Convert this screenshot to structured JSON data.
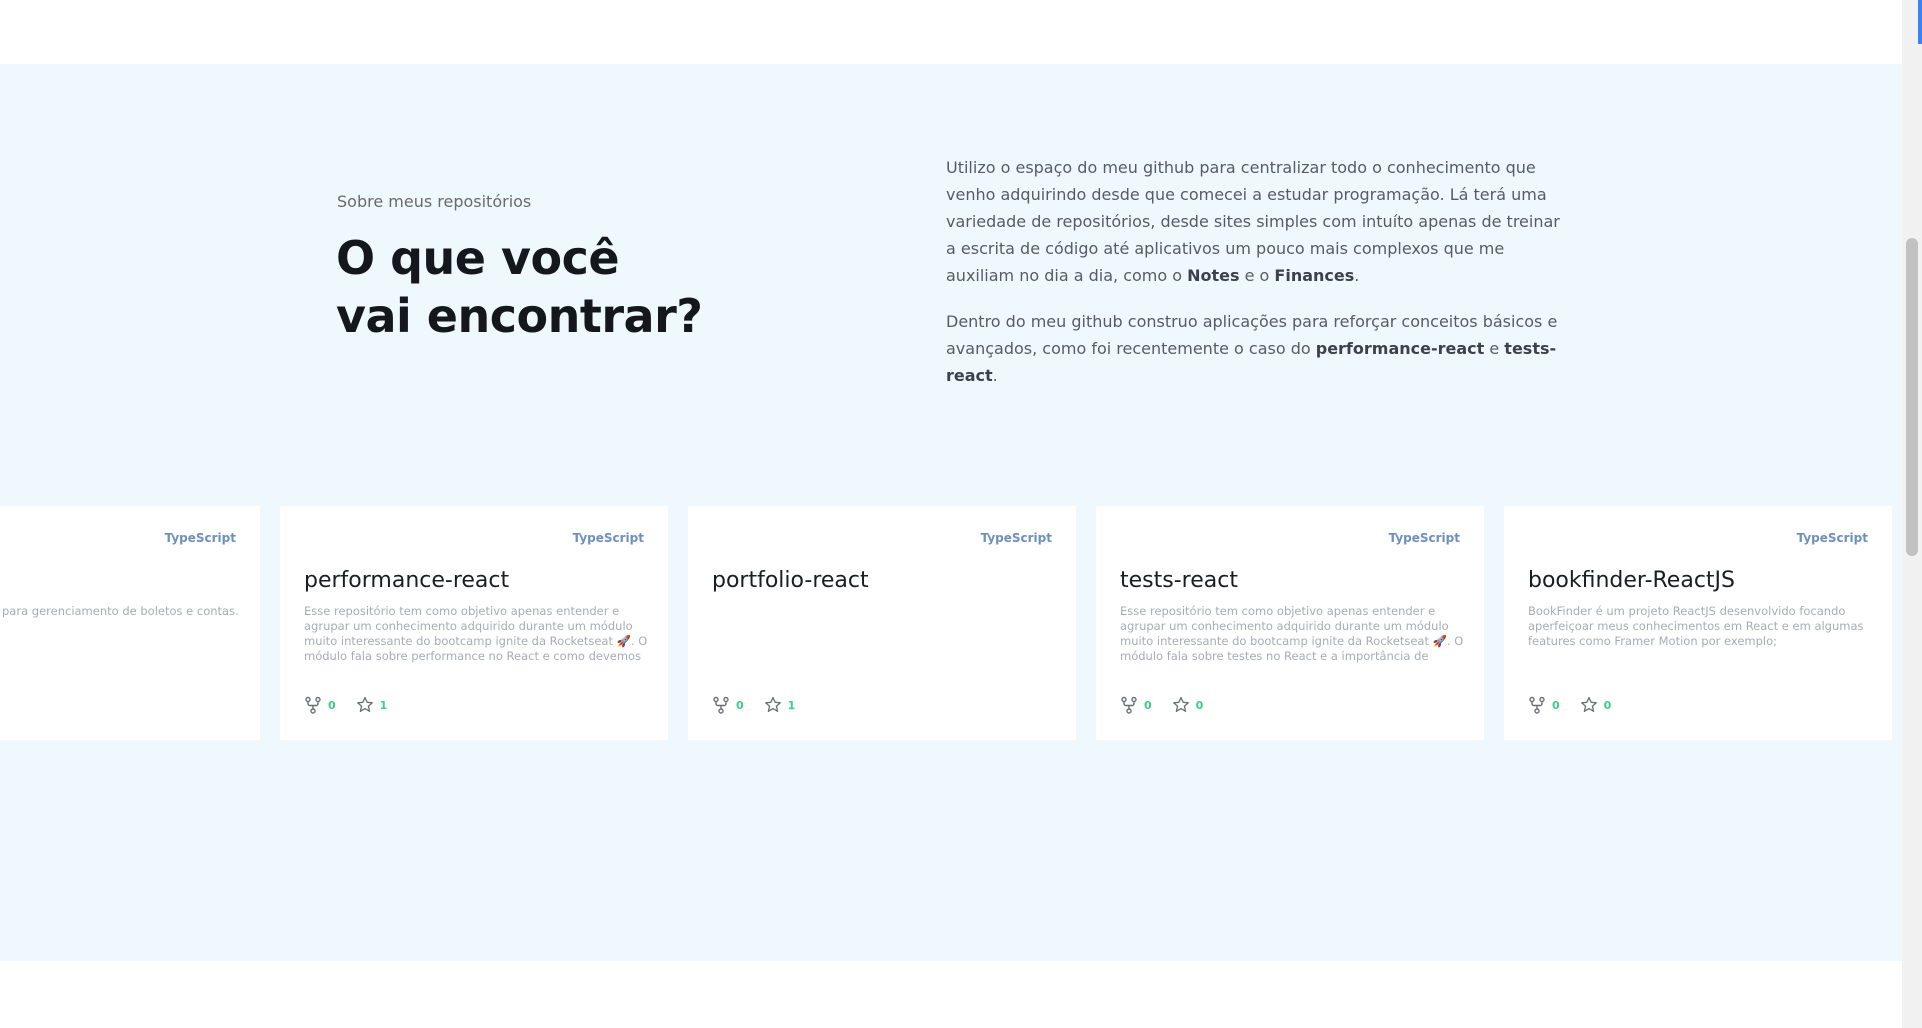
{
  "about": {
    "eyebrow": "Sobre meus repositórios",
    "headline_line1": "O que você",
    "headline_line2": "vai encontrar?",
    "p1_text1": "Utilizo o espaço do meu github para centralizar todo o conhecimento que venho adquirindo desde que comecei a estudar programação. Lá terá uma variedade de repositórios, desde sites simples com intuíto apenas de treinar a escrita de código até aplicativos um pouco mais complexos que me auxiliam no dia a dia, como o ",
    "p1_bold1": "Notes",
    "p1_text2": " e o ",
    "p1_bold2": "Finances",
    "p1_text3": ".",
    "p2_text1": "Dentro do meu github construo aplicações para reforçar conceitos básicos e avançados, como foi recentemente o caso do ",
    "p2_bold1": "performance-react",
    "p2_text2": " e ",
    "p2_bold2": "tests-react",
    "p2_text3": "."
  },
  "repos": [
    {
      "language": "TypeScript",
      "name": "",
      "description": "para gerenciamento de boletos e contas.",
      "forks": "",
      "stars": ""
    },
    {
      "language": "TypeScript",
      "name": "performance-react",
      "description": "Esse repositório tem como objetivo apenas entender e agrupar um conhecimento adquirido durante um módulo muito interessante do bootcamp ignite da Rocketseat 🚀. O módulo fala sobre performance no React e como devemos tratar problemas de performance na aplicação e na...",
      "forks": "0",
      "stars": "1"
    },
    {
      "language": "TypeScript",
      "name": "portfolio-react",
      "description": "",
      "forks": "0",
      "stars": "1"
    },
    {
      "language": "TypeScript",
      "name": "tests-react",
      "description": "Esse repositório tem como objetivo apenas entender e agrupar um conhecimento adquirido durante um módulo muito interessante do bootcamp ignite da Rocketseat 🚀. O módulo fala sobre testes no React e a importância de escrever testes em nossa aplicação.",
      "forks": "0",
      "stars": "0"
    },
    {
      "language": "TypeScript",
      "name": "bookfinder-ReactJS",
      "description": "BookFinder é um projeto ReactJS desenvolvido focando aperfeiçoar meus conhecimentos em React e em algumas features como Framer Motion por exemplo;",
      "forks": "0",
      "stars": "0"
    }
  ],
  "icons": {
    "fork": "fork-icon",
    "star": "star-icon"
  },
  "colors": {
    "section_bg": "#eff9fd",
    "language": "#6f8fbf",
    "stat_count": "#3ccf82"
  }
}
